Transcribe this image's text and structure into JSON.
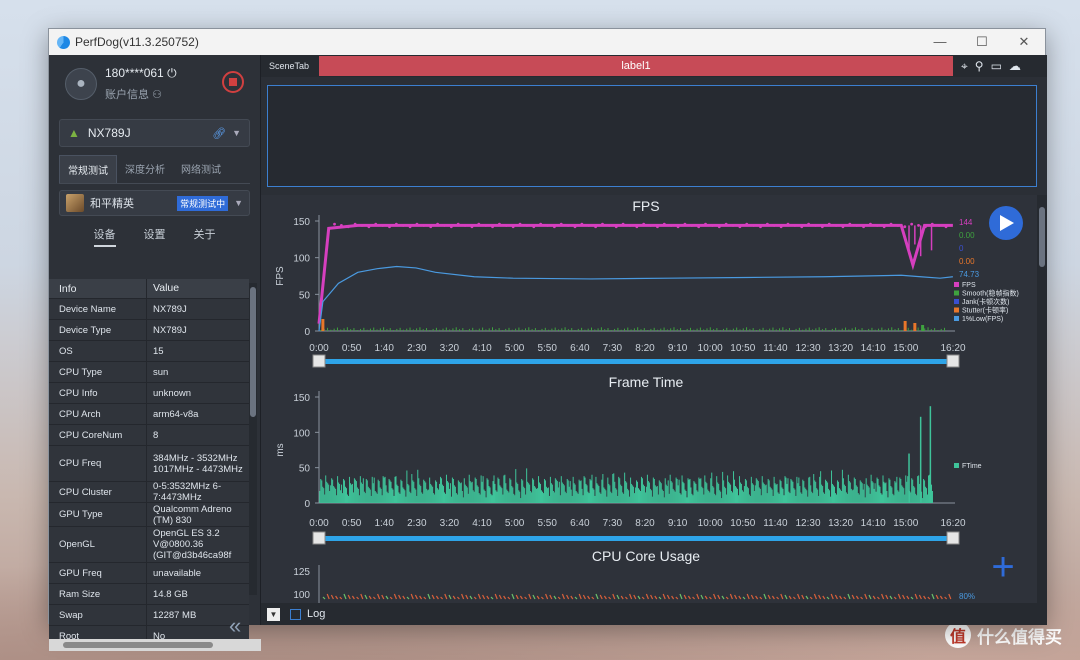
{
  "window": {
    "title": "PerfDog(v11.3.250752)",
    "controls": [
      "—",
      "☐",
      "✕"
    ]
  },
  "user": {
    "name": "180****061",
    "account": "账户信息"
  },
  "device": {
    "name": "NX789J"
  },
  "mode_tabs": [
    "常规测试",
    "深度分析",
    "网络测试"
  ],
  "game": {
    "name": "和平精英",
    "status": "常规测试中"
  },
  "sub_tabs": [
    "设备",
    "设置",
    "关于"
  ],
  "info_table": {
    "headers": [
      "Info",
      "Value"
    ],
    "rows": [
      [
        "Device Name",
        "NX789J"
      ],
      [
        "Device Type",
        "NX789J"
      ],
      [
        "OS",
        "15"
      ],
      [
        "CPU Type",
        "sun"
      ],
      [
        "CPU Info",
        "unknown"
      ],
      [
        "CPU Arch",
        "arm64-v8a"
      ],
      [
        "CPU CoreNum",
        "8"
      ],
      [
        "CPU Freq",
        "384MHz - 3532MHz 1017MHz - 4473MHz"
      ],
      [
        "CPU Cluster",
        "0-5:3532MHz 6-7:4473MHz"
      ],
      [
        "GPU Type",
        "Qualcomm Adreno (TM) 830"
      ],
      [
        "OpenGL",
        "OpenGL ES 3.2 V@0800.36 (GIT@d3b46ca98f"
      ],
      [
        "GPU Freq",
        "unavailable"
      ],
      [
        "Ram Size",
        "14.8 GB"
      ],
      [
        "Swap",
        "12287 MB"
      ],
      [
        "Root",
        "No"
      ]
    ]
  },
  "scene": {
    "tab": "SceneTab",
    "label": "label1"
  },
  "bottom": {
    "log": "Log"
  },
  "watermark": "什么值得买",
  "colors": {
    "fps": "#d63fbf",
    "smooth": "#3fa33f",
    "jank": "#3a4fd0",
    "stutter": "#e8762a",
    "low1": "#4a9ae0",
    "ftime": "#3fc49a",
    "accent": "#2f6bd8",
    "label_tab": "#c74b57"
  },
  "chart_data": [
    {
      "type": "line",
      "title": "FPS",
      "ylabel": "FPS",
      "ylim": [
        0,
        150
      ],
      "yticks": [
        0,
        50,
        100,
        150
      ],
      "xticks": [
        "0:00",
        "0:50",
        "1:40",
        "2:30",
        "3:20",
        "4:10",
        "5:00",
        "5:50",
        "6:40",
        "7:30",
        "8:20",
        "9:10",
        "10:00",
        "10:50",
        "11:40",
        "12:30",
        "13:20",
        "14:10",
        "15:00",
        "16:20"
      ],
      "legend_values": [
        "144",
        "0.00",
        "0",
        "0.00",
        "74.73"
      ],
      "series": [
        {
          "name": "FPS",
          "x_min": [
            0,
            0.25,
            1,
            3,
            6,
            9,
            12,
            14,
            15,
            15.3,
            15.6,
            16,
            16.33
          ],
          "values": [
            10,
            140,
            144,
            144,
            144,
            144,
            144,
            144,
            144,
            90,
            144,
            144,
            144
          ]
        },
        {
          "name": "Smooth(稳帧指数)",
          "x_min": [
            0,
            16.33
          ],
          "values": [
            0,
            0
          ]
        },
        {
          "name": "Jank(卡顿次数)",
          "x_min": [
            0,
            16.33
          ],
          "values": [
            0,
            0
          ]
        },
        {
          "name": "Stutter(卡顿率)",
          "x_min": [
            0,
            16.33
          ],
          "values": [
            0,
            0
          ]
        },
        {
          "name": "1%Low(FPS)",
          "x_min": [
            0,
            0.1,
            0.5,
            1,
            1.5,
            2,
            2.5,
            3,
            4,
            5,
            7,
            9,
            11,
            13,
            15,
            15.5,
            16,
            16.33
          ],
          "values": [
            0,
            40,
            65,
            80,
            85,
            88,
            86,
            80,
            74,
            72,
            71,
            72,
            73,
            74,
            76,
            74,
            72,
            74
          ]
        }
      ]
    },
    {
      "type": "bar",
      "title": "Frame Time",
      "ylabel": "ms",
      "ylim": [
        0,
        150
      ],
      "yticks": [
        0,
        50,
        100,
        150
      ],
      "xticks": [
        "0:00",
        "0:50",
        "1:40",
        "2:30",
        "3:20",
        "4:10",
        "5:00",
        "5:50",
        "6:40",
        "7:30",
        "8:20",
        "9:10",
        "10:00",
        "10:50",
        "11:40",
        "12:30",
        "13:20",
        "14:10",
        "15:00",
        "16:20"
      ],
      "series": [
        {
          "name": "FTime",
          "typical_ms": [
            7,
            35
          ],
          "peaks": [
            {
              "x_min": 15.2,
              "value": 70
            },
            {
              "x_min": 15.5,
              "value": 122
            },
            {
              "x_min": 15.75,
              "value": 137
            }
          ]
        }
      ]
    },
    {
      "type": "line",
      "title": "CPU Core Usage",
      "ylim": [
        0,
        125
      ],
      "yticks": [
        100,
        125
      ],
      "legend_values": [
        "80%"
      ]
    }
  ]
}
